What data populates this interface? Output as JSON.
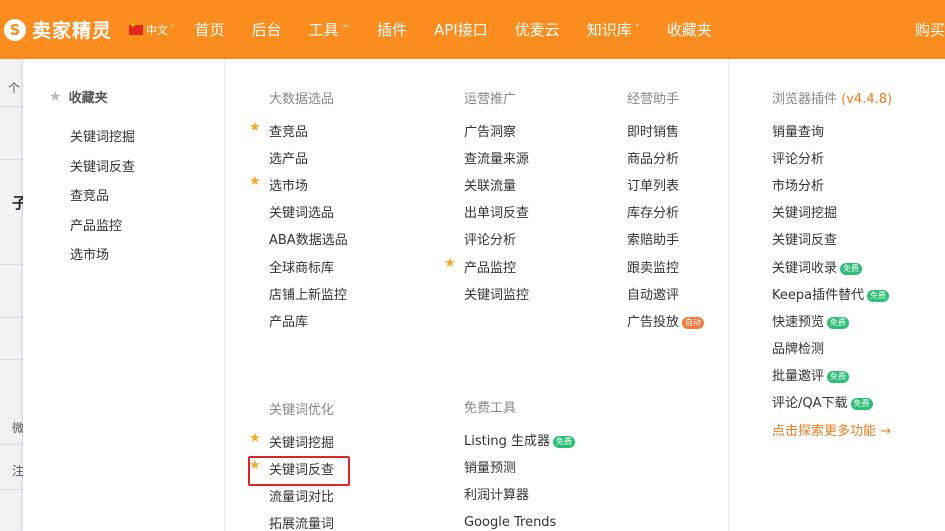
{
  "topbar": {
    "logo_mark": "S",
    "logo_text": "卖家精灵",
    "lang_label": "中文",
    "nav": [
      {
        "label": "首页",
        "dropdown": false
      },
      {
        "label": "后台",
        "dropdown": false
      },
      {
        "label": "工具",
        "dropdown": true,
        "chevron": "^"
      },
      {
        "label": "插件",
        "dropdown": false
      },
      {
        "label": "API接口",
        "dropdown": false
      },
      {
        "label": "优麦云",
        "dropdown": false
      },
      {
        "label": "知识库",
        "dropdown": true,
        "chevron": "ˇ"
      },
      {
        "label": "收藏夹",
        "dropdown": false
      }
    ],
    "right_label": "购买",
    "color": "#fb8c1e"
  },
  "background": {
    "fragments": [
      "个",
      "子",
      "微",
      "注"
    ]
  },
  "favorites": {
    "title": "收藏夹",
    "items": [
      "关键词挖掘",
      "关键词反查",
      "查竞品",
      "产品监控",
      "选市场"
    ]
  },
  "big_data": {
    "title": "大数据选品",
    "items": [
      {
        "label": "查竞品",
        "pinned": true
      },
      {
        "label": "选产品",
        "pinned": false
      },
      {
        "label": "选市场",
        "pinned": true
      },
      {
        "label": "关键词选品",
        "pinned": false
      },
      {
        "label": "ABA数据选品",
        "pinned": false
      },
      {
        "label": "全球商标库",
        "pinned": false
      },
      {
        "label": "店铺上新监控",
        "pinned": false
      },
      {
        "label": "产品库",
        "pinned": false
      }
    ]
  },
  "operations": {
    "title": "运营推广",
    "items": [
      {
        "label": "广告洞察",
        "pinned": false
      },
      {
        "label": "查流量来源",
        "pinned": false
      },
      {
        "label": "关联流量",
        "pinned": false
      },
      {
        "label": "出单词反查",
        "pinned": false
      },
      {
        "label": "评论分析",
        "pinned": false
      },
      {
        "label": "产品监控",
        "pinned": true
      },
      {
        "label": "关键词监控",
        "pinned": false
      }
    ]
  },
  "assistant": {
    "title": "经营助手",
    "items": [
      {
        "label": "即时销售",
        "badge": ""
      },
      {
        "label": "商品分析",
        "badge": ""
      },
      {
        "label": "订单列表",
        "badge": ""
      },
      {
        "label": "库存分析",
        "badge": ""
      },
      {
        "label": "索赔助手",
        "badge": ""
      },
      {
        "label": "跟卖监控",
        "badge": ""
      },
      {
        "label": "自动邀评",
        "badge": ""
      },
      {
        "label": "广告投放",
        "badge": "自动"
      }
    ]
  },
  "keyword_opt": {
    "title": "关键词优化",
    "items": [
      {
        "label": "关键词挖掘",
        "pinned": true
      },
      {
        "label": "关键词反查",
        "pinned": true
      },
      {
        "label": "流量词对比",
        "pinned": false
      },
      {
        "label": "拓展流量词",
        "pinned": false
      }
    ]
  },
  "free_tools": {
    "title": "免费工具",
    "items": [
      {
        "label": "Listing 生成器",
        "badge": "免费"
      },
      {
        "label": "销量预测",
        "badge": ""
      },
      {
        "label": "利润计算器",
        "badge": ""
      },
      {
        "label": "Google Trends",
        "badge": ""
      }
    ]
  },
  "browser_plugin": {
    "title": "浏览器插件",
    "version": "(v4.4.8)",
    "items": [
      {
        "label": "销量查询",
        "badge": ""
      },
      {
        "label": "评论分析",
        "badge": ""
      },
      {
        "label": "市场分析",
        "badge": ""
      },
      {
        "label": "关键词挖掘",
        "badge": ""
      },
      {
        "label": "关键词反查",
        "badge": ""
      },
      {
        "label": "关键词收录",
        "badge": "免费"
      },
      {
        "label": "Keepa插件替代",
        "badge": "免费"
      },
      {
        "label": "快速预览",
        "badge": "免费"
      },
      {
        "label": "品牌检测",
        "badge": ""
      },
      {
        "label": "批量邀评",
        "badge": "免费"
      },
      {
        "label": "评论/QA下载",
        "badge": "免费"
      }
    ],
    "more_link": "点击探索更多功能 →"
  },
  "colors": {
    "accent": "#f07c1e",
    "pin_star": "#f5a623",
    "free_badge": "#2cbf75",
    "auto_badge": "#f47b3b",
    "highlight": "#e0252a"
  }
}
